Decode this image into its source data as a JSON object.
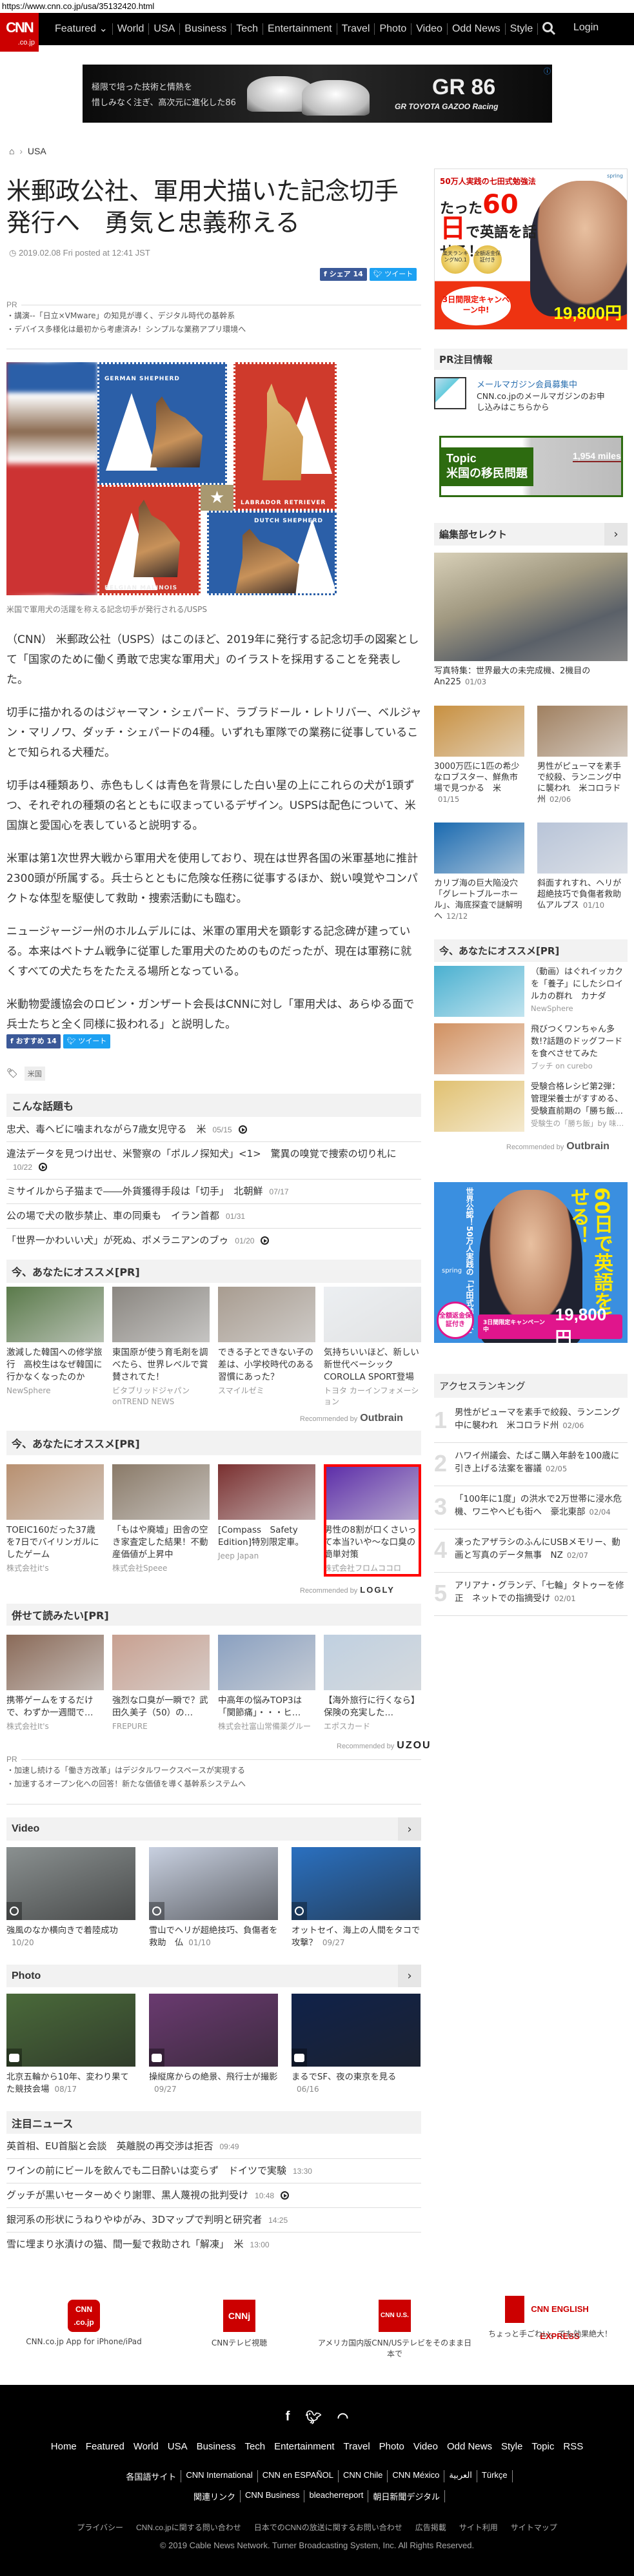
{
  "url": "https://www.cnn.co.jp/usa/35132420.html",
  "nav": {
    "logo": "CNN",
    "logo_sub": ".co.jp",
    "items": [
      "Featured ⌄",
      "World",
      "USA",
      "Business",
      "Tech",
      "Entertainment",
      "Travel",
      "Photo",
      "Video",
      "Odd News",
      "Style"
    ],
    "login": "Login"
  },
  "top_ad": {
    "line1": "極限で培った技術と情熱を",
    "line2": "惜しみなく注ぎ、高次元に進化した86",
    "model": "GR 86",
    "brand": "GR TOYOTA GAZOO Racing"
  },
  "breadcrumb": {
    "current": "USA"
  },
  "article": {
    "title_line1": "米郵政公社、軍用犬描いた記念切手",
    "title_line2": "発行へ　勇気と忠義称える",
    "date": "2019.02.08 Fri posted at 12:41 JST",
    "share_top": {
      "facebook": "シェア 14",
      "twitter": "ツイート"
    },
    "pr": {
      "label": "PR",
      "items": [
        "講演--「日立×VMware」の知見が導く、デジタル時代の基幹系",
        "デバイス多様化は最初から考慮済み！シンプルな業務アプリ環境へ"
      ]
    },
    "stamps": [
      "GERMAN SHEPHERD",
      "LABRADOR RETRIEVER",
      "BELGIAN MALINOIS",
      "DUTCH SHEPHERD"
    ],
    "caption": "米国で軍用犬の活躍を称える記念切手が発行される/USPS",
    "paragraphs": [
      "（CNN） 米郵政公社（USPS）はこのほど、2019年に発行する記念切手の図案として「国家のために働く勇敢で忠実な軍用犬」のイラストを採用することを発表した。",
      "切手に描かれるのはジャーマン・シェパード、ラブラドール・レトリバー、ベルジャン・マリノワ、ダッチ・シェパードの4種。いずれも軍隊での業務に従事していることで知られる犬種だ。",
      "切手は4種類あり、赤色もしくは青色を背景にした白い星の上にこれらの犬が1頭ずつ、それぞれの種類の名とともに収まっているデザイン。USPSは配色について、米国旗と愛国心を表していると説明する。",
      "米軍は第1次世界大戦から軍用犬を使用しており、現在は世界各国の米軍基地に推計2300頭が所属する。兵士らとともに危険な任務に従事するほか、鋭い嗅覚やコンパクトな体型を駆使して救助・捜索活動にも臨む。",
      "ニュージャージー州のホルムデルには、米軍の軍用犬を顕彰する記念碑が建っている。本来はベトナム戦争に従軍した軍用犬のためのものだったが、現在は軍務に就くすべての犬たちをたたえる場所となっている。",
      "米動物愛護協会のロビン・ガンザート会長はCNNに対し「軍用犬は、あらゆる面で兵士たちと全く同様に扱われる」と説明した。"
    ],
    "share_bottom": {
      "facebook": "おすすめ 14",
      "twitter": "ツイート"
    },
    "tag": "米国"
  },
  "related": {
    "title": "こんな話題も",
    "items": [
      {
        "text": "忠犬、毒ヘビに噛まれながら7歳女児守る　米",
        "date": "05/15",
        "video": true
      },
      {
        "text": "違法データを見つけ出せ、米警察の「ポルノ探知犬」<1>　驚異の嗅覚で捜索の切り札に",
        "date": "10/22",
        "video": true
      },
      {
        "text": "ミサイルから子猫まで――外貨獲得手段は「切手」　北朝鮮",
        "date": "07/17",
        "video": false
      },
      {
        "text": "公の場で犬の散歩禁止、車の同乗も　イラン首都",
        "date": "01/31",
        "video": false
      },
      {
        "text": "「世界一かわいい犬」が死ぬ、ポメラニアンのブゥ",
        "date": "01/20",
        "video": true
      }
    ]
  },
  "reco1": {
    "title": "今、あなたにオススメ[PR]",
    "items": [
      {
        "text": "激減した韓国への修学旅行　高校生はなぜ韓国に行かなくなったのか",
        "source": "NewSphere",
        "color": "#5a7a4a"
      },
      {
        "text": "東国原が使う育毛剤を調べたら、世界レベルで賞賛されてた！",
        "source": "ビタブリッドジャパン onTREND NEWS",
        "color": "#8a8680"
      },
      {
        "text": "できる子とできない子の差は、小学校時代のある習慣にあった？",
        "source": "スマイルゼミ",
        "color": "#a89c90"
      },
      {
        "text": "気持ちいいほど、新しい新世代ベーシック COROLLA SPORT登場",
        "source": "トヨタ カーインフォメーション",
        "color": "#eceff2"
      }
    ],
    "recommended_by": "Recommended by",
    "provider": "Outbrain"
  },
  "reco2": {
    "title": "今、あなたにオススメ[PR]",
    "items": [
      {
        "text": "TOEIC160だった37歳を7日でバイリンガルにしたゲーム",
        "source": "株式会社it's",
        "color": "#b89070"
      },
      {
        "text": "「もはや廃墟」田舎の空き家査定した結果！不動産価値が上昇中",
        "source": "株式会社Speee",
        "color": "#8a7a68"
      },
      {
        "text": "[Compass　Safety Edition]特別限定車。",
        "source": "Jeep Japan",
        "color": "#7a3030"
      },
      {
        "text": "男性の8割が口くさいって本当?いや～な口臭の簡単対策",
        "source": "株式会社フロムココロ",
        "color": "#5a2aa8"
      }
    ],
    "recommended_by": "Recommended by",
    "provider": "LOGLY"
  },
  "reco3": {
    "title": "併せて読みたい[PR]",
    "items": [
      {
        "text": "携帯ゲームをするだけで、わずか一週間で…",
        "source": "株式会社It's",
        "color": "#8a6a58"
      },
      {
        "text": "強烈な口臭が一瞬で？武田久美子（50）の…",
        "source": "FREPURE",
        "color": "#c8a090"
      },
      {
        "text": "中高年の悩みTOP3は「関節痛」・・・ヒ…",
        "source": "株式会社富山常備薬グルー",
        "color": "#8aa0c0"
      },
      {
        "text": "【海外旅行に行くなら】保険の充実した…",
        "source": "エポスカード",
        "color": "#c0d0e0"
      }
    ],
    "recommended_by": "Recommended by",
    "provider": "UZOU"
  },
  "pr_bottom": {
    "label": "PR",
    "items": [
      "加速し続ける「働き方改革」はデジタルワークスペースが実現する",
      "加速するオープン化への回答！新たな価値を導く基幹系システムへ"
    ]
  },
  "video": {
    "title": "Video",
    "items": [
      {
        "text": "強風のなか横向きで着陸成功",
        "date": "10/20",
        "color": "#8a9090"
      },
      {
        "text": "雪山でヘリが超絶技巧、負傷者を救助　仏",
        "date": "01/10",
        "color": "#c8d0e0"
      },
      {
        "text": "オットセイ、海上の人間をタコで攻撃？",
        "date": "09/27",
        "color": "#2a70c0"
      }
    ]
  },
  "photo": {
    "title": "Photo",
    "items": [
      {
        "text": "北京五輪から10年、変わり果てた競技会場",
        "date": "08/17",
        "color": "#4a6a3a"
      },
      {
        "text": "操縦席からの絶景、飛行士が撮影",
        "date": "09/27",
        "color": "#6a3a70"
      },
      {
        "text": "まるでSF、夜の東京を見る",
        "date": "06/16",
        "color": "#10224a"
      }
    ]
  },
  "featured_news": {
    "title": "注目ニュース",
    "items": [
      {
        "text": "英首相、EU首脳と会談　英離脱の再交渉は拒否",
        "date": "09:49",
        "video": false
      },
      {
        "text": "ワインの前にビールを飲んでも二日酔いは変らず　ドイツで実験",
        "date": "13:30",
        "video": false
      },
      {
        "text": "グッチが黒いセーターめぐり謝罪、黒人蔑視の批判受け",
        "date": "10:48",
        "video": true
      },
      {
        "text": "銀河系の形状にうねりやゆがみ、3Dマップで判明と研究者",
        "date": "14:25",
        "video": false
      },
      {
        "text": "雪に埋まり氷漬けの猫、間一髪で救助され「解凍」　米",
        "date": "13:00",
        "video": false
      }
    ]
  },
  "apps": [
    {
      "logo": "CNN .co.jp",
      "caption": "CNN.co.jp App for iPhone/iPad"
    },
    {
      "logo": "CNNj",
      "caption": "CNNテレビ視聴"
    },
    {
      "logo": "CNN U.S.",
      "caption": "アメリカ国内版CNN/USテレビをそのまま日本で"
    },
    {
      "logo": "CNN ENGLISH EXPRESS",
      "caption": "ちょっと手ごわい、でも効果絶大！"
    }
  ],
  "footer": {
    "social": [
      "f",
      "t",
      "rss"
    ],
    "nav": [
      "Home",
      "Featured",
      "World",
      "USA",
      "Business",
      "Tech",
      "Entertainment",
      "Travel",
      "Photo",
      "Video",
      "Odd News",
      "Style",
      "Topic",
      "RSS"
    ],
    "intl_label": "各国語サイト",
    "intl": [
      "CNN International",
      "CNN en ESPAÑOL",
      "CNN Chile",
      "CNN México",
      "العربية",
      "Türkçe"
    ],
    "related_label": "関連リンク",
    "related": [
      "CNN Business",
      "bleacherreport",
      "朝日新聞デジタル"
    ],
    "bottom": [
      "プライバシー",
      "CNN.co.jpに関する問い合わせ",
      "日本でのCNNの放送に関するお問い合わせ",
      "広告掲載",
      "サイト利用",
      "サイトマップ"
    ],
    "copyright": "© 2019 Cable News Network.  Turner Broadcasting System, Inc.  All Rights Reserved."
  },
  "sidebar": {
    "ad1": {
      "top": "50万人実践の七田式勉強法",
      "head1": "たった",
      "num": "60日",
      "head2": "で英語を話せる！",
      "badge1": "楽天ランキングNO.1",
      "badge2": "全額返金保証付き",
      "bubble": "3日間限定キャンペーン中!",
      "price": "19,800円",
      "brand": "spring"
    },
    "pr_info": {
      "title": "PR注目情報",
      "link": "メールマガジン会員募集中",
      "desc": "CNN.co.jpのメールマガジンのお申し込みはこちらから"
    },
    "topic": {
      "label": "Topic",
      "title": "米国の移民問題",
      "miles": "1,954 miles"
    },
    "editors": {
      "title": "編集部セレクト",
      "main": {
        "text": "写真特集：世界最大の未完成機、2機目のAn225",
        "date": "01/03"
      },
      "items": [
        {
          "text": "3000万匹に1匹の希少なロブスター、鮮魚市場で見つかる　米",
          "date": "01/15",
          "color": "#c89040"
        },
        {
          "text": "男性がピューマを素手で絞殺、ランニング中に襲われ　米コロラド州",
          "date": "02/06",
          "color": "#a08060"
        },
        {
          "text": "カリブ海の巨大陥没穴「グレートブルーホール」、海底探査で謎解明へ",
          "date": "12/12",
          "color": "#1a6ab0"
        },
        {
          "text": "斜面すれすれ、ヘリが超絶技巧で負傷者救助　仏アルプス",
          "date": "01/10",
          "color": "#b8c4d8"
        }
      ]
    },
    "reco": {
      "title": "今、あなたにオススメ[PR]",
      "items": [
        {
          "text": "（動画）はぐれイッカクを「養子」にしたシロイルカの群れ　カナダ",
          "source": "NewSphere",
          "color": "#4ab0d0"
        },
        {
          "text": "飛びつくワンちゃん多数!?話題のドッグフードを食べさせてみた",
          "source": "ブッチ on curebo",
          "color": "#d09060"
        },
        {
          "text": "受験合格レシピ第2弾：管理栄養士がすすめる、受験直前期の「勝ち飯…",
          "source": "受験生の「勝ち飯」by 味…",
          "color": "#e0c070"
        }
      ],
      "recommended_by": "Recommended by",
      "provider": "Outbrain"
    },
    "ad2": {
      "v1": "60日で英語を話せる！",
      "v2": "世界公認！50万人実践の「七田式勉強法」",
      "brand": "spring",
      "circle": "全額返金保証付き",
      "bar_small": "3日間限定キャンペーン中",
      "price": "19,800円"
    },
    "ranking": {
      "title": "アクセスランキング",
      "items": [
        {
          "n": "1",
          "text": "男性がピューマを素手で絞殺、ランニング中に襲われ　米コロラド州",
          "date": "02/06"
        },
        {
          "n": "2",
          "text": "ハワイ州議会、たばこ購入年齢を100歳に引き上げる法案を審議",
          "date": "02/05"
        },
        {
          "n": "3",
          "text": "「100年に1度」の洪水で2万世帯に浸水危機、ワニやヘビも街へ　豪北東部",
          "date": "02/04"
        },
        {
          "n": "4",
          "text": "凍ったアザラシのふんにUSBメモリー、動画と写真のデータ無事　NZ",
          "date": "02/07"
        },
        {
          "n": "5",
          "text": "アリアナ・グランデ、「七輪」タトゥーを修正　ネットでの指摘受け",
          "date": "02/01"
        }
      ]
    }
  }
}
